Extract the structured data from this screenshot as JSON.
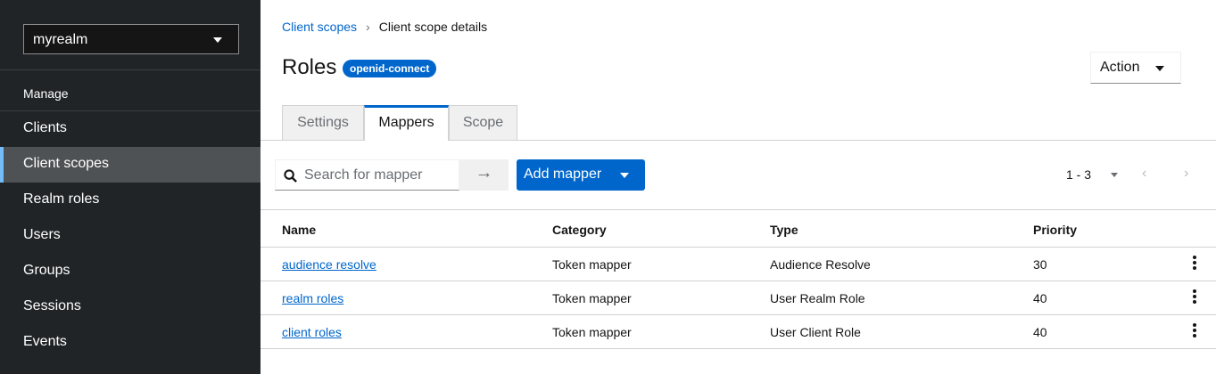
{
  "sidebar": {
    "realm": "myrealm",
    "section": "Manage",
    "items": [
      "Clients",
      "Client scopes",
      "Realm roles",
      "Users",
      "Groups",
      "Sessions",
      "Events"
    ],
    "active": "Client scopes"
  },
  "breadcrumb": [
    "Client scopes",
    "Client scope details"
  ],
  "header": {
    "title": "Roles",
    "badge": "openid-connect",
    "action": "Action"
  },
  "tabs": [
    "Settings",
    "Mappers",
    "Scope"
  ],
  "toolbar": {
    "search_placeholder": "Search for mapper",
    "add": "Add mapper",
    "pagination": "1 - 3"
  },
  "table": {
    "columns": [
      "Name",
      "Category",
      "Type",
      "Priority"
    ],
    "rows": [
      [
        "audience resolve",
        "Token mapper",
        "Audience Resolve",
        "30"
      ],
      [
        "realm roles",
        "Token mapper",
        "User Realm Role",
        "40"
      ],
      [
        "client roles",
        "Token mapper",
        "User Client Role",
        "40"
      ]
    ]
  }
}
